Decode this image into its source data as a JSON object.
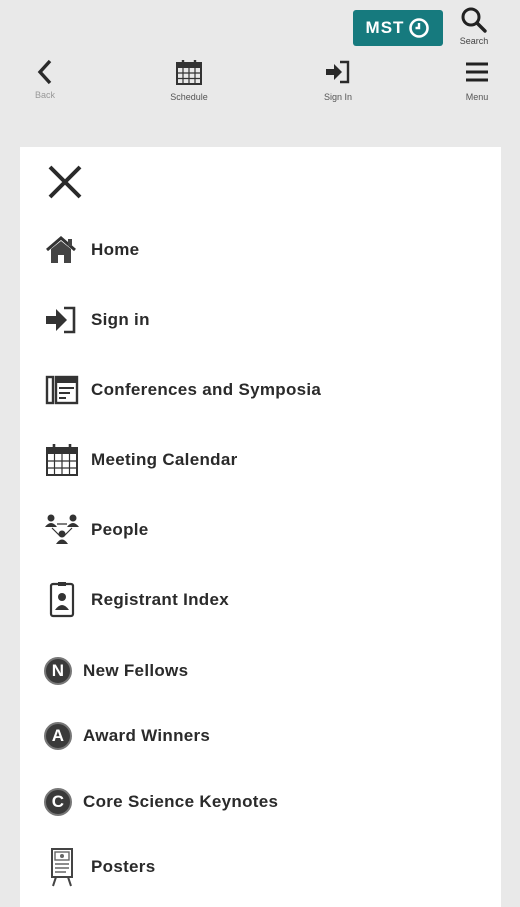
{
  "header": {
    "mst_label": "MST",
    "search_label": "Search",
    "back_label": "Back",
    "schedule_label": "Schedule",
    "signin_label": "Sign In",
    "menu_label": "Menu",
    "accent_color": "#167a7e"
  },
  "menu": {
    "items": [
      {
        "label": "Home",
        "icon": "home-icon"
      },
      {
        "label": "Sign in",
        "icon": "sign-in-icon"
      },
      {
        "label": "Conferences and Symposia",
        "icon": "conferences-icon"
      },
      {
        "label": "Meeting Calendar",
        "icon": "calendar-icon"
      },
      {
        "label": "People",
        "icon": "people-icon"
      },
      {
        "label": "Registrant Index",
        "icon": "badge-icon"
      },
      {
        "label": "New Fellows",
        "icon": "letter-n-icon",
        "letter": "N"
      },
      {
        "label": "Award Winners",
        "icon": "letter-a-icon",
        "letter": "A"
      },
      {
        "label": "Core Science Keynotes",
        "icon": "letter-c-icon",
        "letter": "C"
      },
      {
        "label": "Posters",
        "icon": "poster-icon"
      }
    ]
  }
}
